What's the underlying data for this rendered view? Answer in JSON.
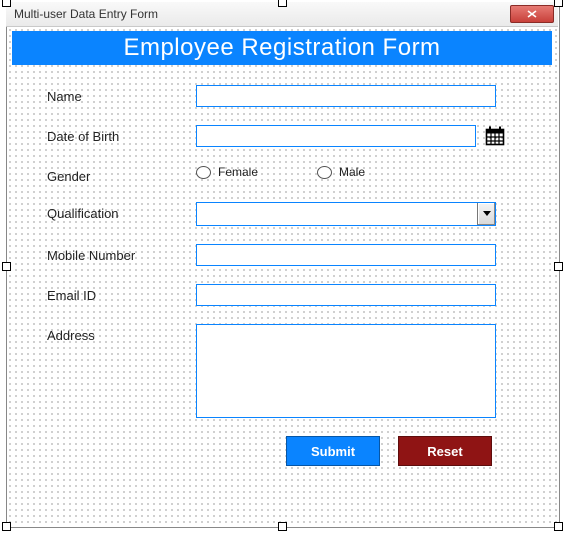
{
  "window": {
    "title": "Multi-user Data Entry Form"
  },
  "header": {
    "title": "Employee Registration Form"
  },
  "form": {
    "name": {
      "label": "Name",
      "value": ""
    },
    "dob": {
      "label": "Date of Birth",
      "value": ""
    },
    "gender": {
      "label": "Gender",
      "options": {
        "female": "Female",
        "male": "Male"
      },
      "value": ""
    },
    "qualification": {
      "label": "Qualification",
      "value": ""
    },
    "mobile": {
      "label": "Mobile Number",
      "value": ""
    },
    "email": {
      "label": "Email ID",
      "value": ""
    },
    "address": {
      "label": "Address",
      "value": ""
    }
  },
  "buttons": {
    "submit": "Submit",
    "reset": "Reset"
  },
  "colors": {
    "accent": "#0a84ff",
    "danger": "#8f1414"
  }
}
